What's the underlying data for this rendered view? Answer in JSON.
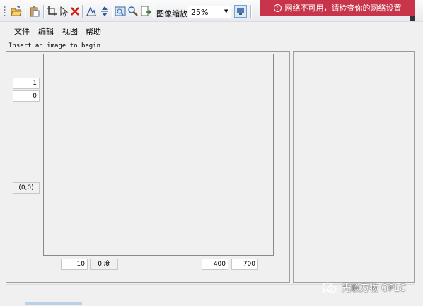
{
  "toolbar": {
    "zoom_label": "图像缩放:",
    "zoom_value": "25%",
    "icons": [
      "open-icon",
      "paste-icon",
      "crop-icon",
      "pointer-icon",
      "delete-icon",
      "edge-icon",
      "flip-icon",
      "fit-image-icon",
      "zoom-icon",
      "export-icon",
      "screen-icon"
    ]
  },
  "notification": {
    "text": "网络不可用，请检查你的网络设置",
    "color": "#c8354a"
  },
  "menu": {
    "file": "文件",
    "edit": "编辑",
    "view": "视图",
    "help": "帮助"
  },
  "status": {
    "message": "Insert an image to begin"
  },
  "left_panel": {
    "value_top": "1",
    "value_second": "0",
    "coords": "(0,0)"
  },
  "bottom_controls": {
    "value_10": "10",
    "angle": "0 度",
    "width": "400",
    "height": "700"
  },
  "watermark": {
    "text": "光联万物 OPLC"
  }
}
